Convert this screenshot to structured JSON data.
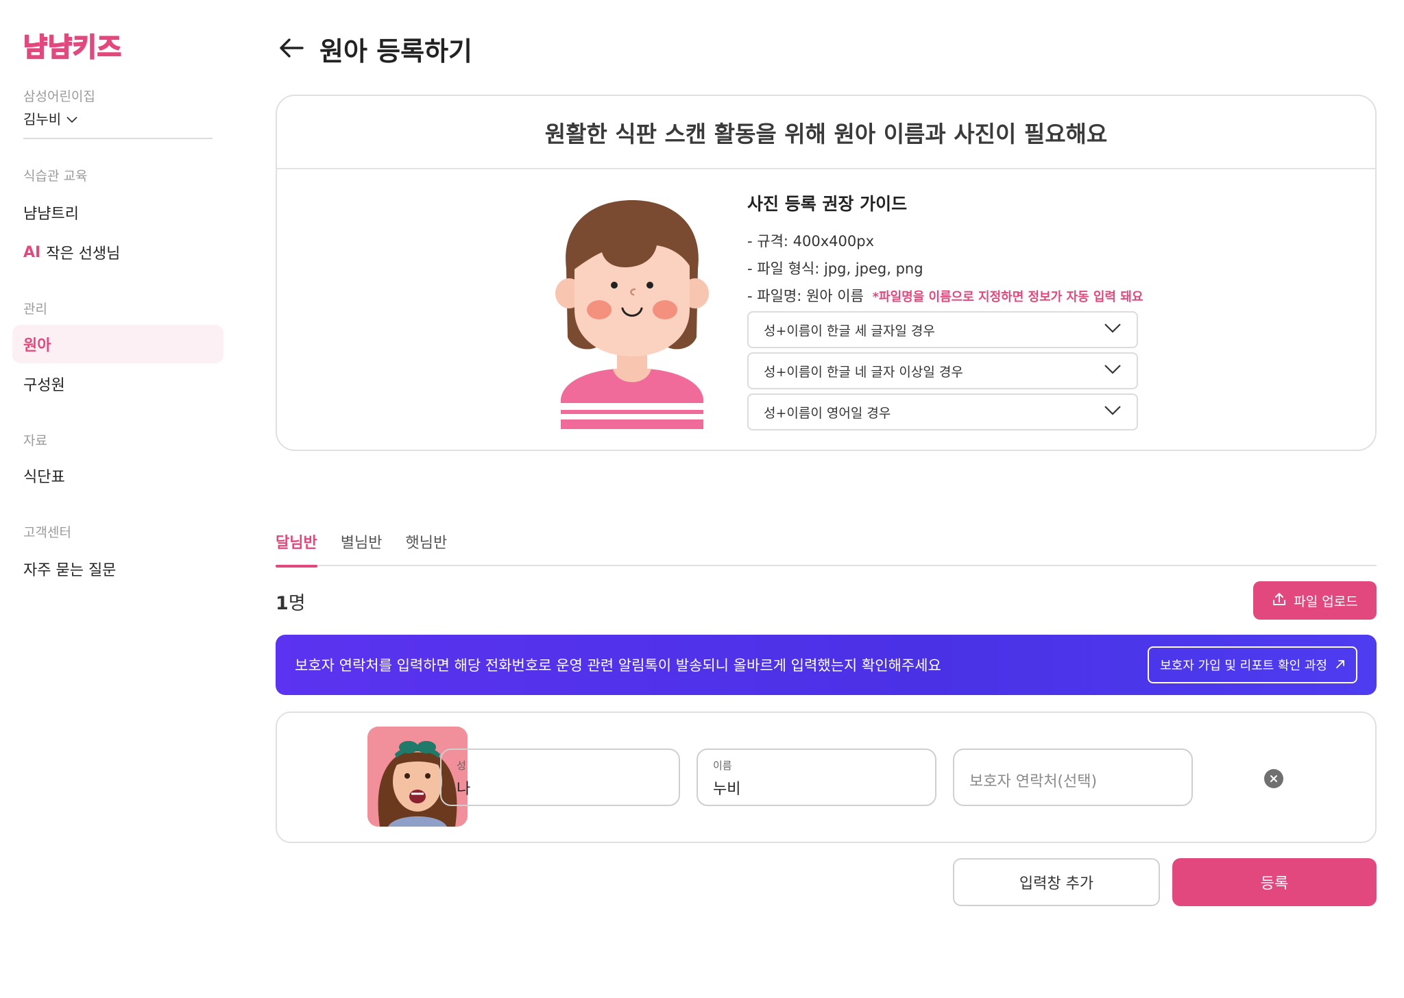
{
  "colors": {
    "accent": "#e2487d",
    "banner": "#4a31e6",
    "text": "#222222",
    "muted": "#9a9a9a"
  },
  "sidebar": {
    "logo_text": "냠냠키즈",
    "org_name": "삼성어린이집",
    "user_name": "김누비",
    "sections": [
      {
        "label": "식습관 교육",
        "items": [
          {
            "label": "냠냠트리"
          },
          {
            "badge": "AI",
            "label": "작은 선생님"
          }
        ]
      },
      {
        "label": "관리",
        "items": [
          {
            "label": "원아",
            "active": true
          },
          {
            "label": "구성원"
          }
        ]
      },
      {
        "label": "자료",
        "items": [
          {
            "label": "식단표"
          }
        ]
      },
      {
        "label": "고객센터",
        "items": [
          {
            "label": "자주 묻는 질문"
          }
        ]
      }
    ]
  },
  "header": {
    "title": "원아 등록하기",
    "back_icon": "arrow-left-icon"
  },
  "guide": {
    "heading": "원활한 식판 스캔 활동을 위해 원아 이름과 사진이 필요해요",
    "title": "사진 등록 권장 가이드",
    "lines": [
      "- 규격: 400x400px",
      "- 파일 형식: jpg, jpeg, png",
      "- 파일명: 원아 이름"
    ],
    "note": "*파일명을 이름으로 지정하면 정보가 자동 입력 돼요",
    "accordions": [
      "성+이름이 한글 세 글자일 경우",
      "성+이름이 한글 네 글자 이상일 경우",
      "성+이름이 영어일 경우"
    ]
  },
  "tabs": [
    {
      "label": "달님반",
      "active": true
    },
    {
      "label": "별님반",
      "active": false
    },
    {
      "label": "햇님반",
      "active": false
    }
  ],
  "count": {
    "number": "1",
    "unit": "명"
  },
  "upload_button": "파일 업로드",
  "banner": {
    "text": "보호자 연락처를 입력하면 해당 전화번호로 운영 관련 알림톡이 발송되니 올바르게 입력했는지 확인해주세요",
    "link_label": "보호자 가입 및 리포트 확인 과정"
  },
  "entry": {
    "last_name": {
      "label": "성",
      "value": "나"
    },
    "first_name": {
      "label": "이름",
      "value": "누비"
    },
    "guardian_phone": {
      "placeholder": "보호자 연락처(선택)"
    }
  },
  "buttons": {
    "add": "입력창 추가",
    "submit": "등록"
  }
}
